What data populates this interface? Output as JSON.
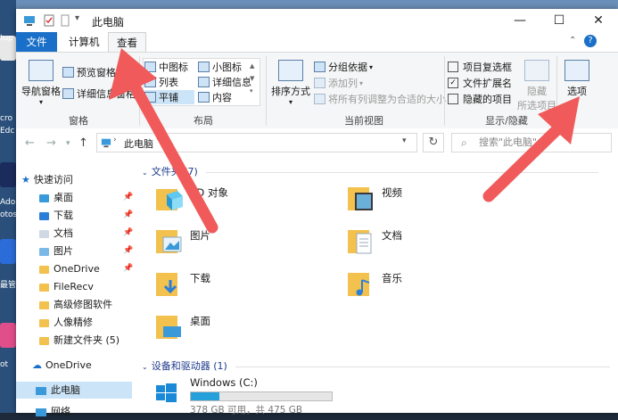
{
  "desktop": {
    "labels": [
      "tup",
      "cro",
      "Edc",
      "Ador",
      "otos",
      "最管",
      "ot"
    ]
  },
  "titlebar": {
    "title": "此电脑",
    "minimize": "—",
    "maximize": "☐",
    "close": "✕"
  },
  "ribbon_tabs": [
    "文件",
    "计算机",
    "查看"
  ],
  "ribbon": {
    "panes": {
      "label": "窗格",
      "navigation_pane": "导航窗格",
      "preview_pane": "预览窗格",
      "details_pane": "详细信息窗格"
    },
    "layout": {
      "label": "布局",
      "items": [
        "中图标",
        "小图标",
        "列表",
        "详细信息",
        "平铺",
        "内容"
      ]
    },
    "current_view": {
      "label": "当前视图",
      "sort_by": "排序方式",
      "group_by": "分组依据",
      "add_columns": "添加列",
      "size_all_columns": "将所有列调整为合适的大小"
    },
    "show_hide": {
      "label": "显示/隐藏",
      "item_checkboxes": "项目复选框",
      "file_name_extensions": "文件扩展名",
      "hidden_items": "隐藏的项目",
      "hide_selected": "隐藏",
      "hide_selected_sub": "所选项目",
      "options": "选项",
      "checked": {
        "item_checkboxes": false,
        "file_name_extensions": true,
        "hidden_items": false
      }
    }
  },
  "address": {
    "path": "此电脑",
    "search_placeholder": "搜索\"此电脑\""
  },
  "sidebar": {
    "quick_access": "快速访问",
    "items": [
      "桌面",
      "下载",
      "文档",
      "图片",
      "OneDrive",
      "FileRecv",
      "高级修图软件",
      "人像精修",
      "新建文件夹 (5)"
    ],
    "onedrive": "OneDrive",
    "this_pc": "此电脑",
    "network": "网络"
  },
  "content": {
    "folders_header": "文件夹 (7)",
    "folders": [
      "3D 对象",
      "视频",
      "图片",
      "文档",
      "下载",
      "音乐",
      "桌面"
    ],
    "devices_header": "设备和驱动器 (1)",
    "drive": {
      "name": "Windows (C:)",
      "info": "378 GB 可用，共 475 GB",
      "used_fraction": 0.204
    }
  },
  "colors": {
    "accent": "#1a6fc8",
    "arrow": "#f05a5a",
    "drive_fill": "#26a0da"
  }
}
